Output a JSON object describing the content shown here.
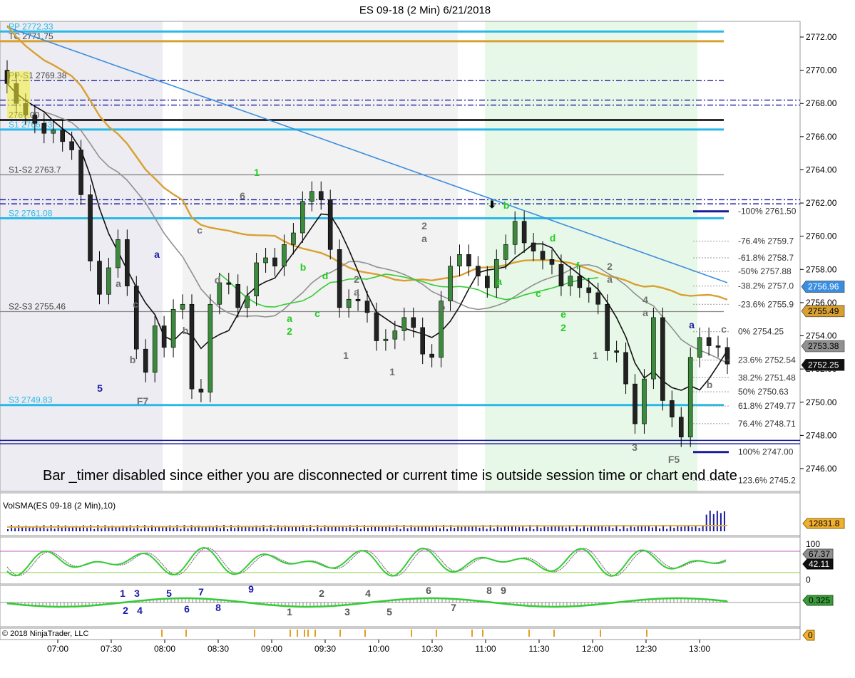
{
  "window_title": "ES 09-18 (2 Min)  6/21/2018",
  "copyright": "© 2018 NinjaTrader, LLC",
  "timer_message": "Bar _timer disabled since either you are disconnected or current time is outside session time or chart end date",
  "colors": {
    "candle_up": "#3c8a3c",
    "candle_down": "#222222",
    "pivot_cyan": "#29b9e8",
    "pivot_navy": "#1a1a9a",
    "ema_gold": "#d8a030",
    "ma_blue": "#3a8ee0",
    "ma_gray": "#909090",
    "ma_black": "#111111",
    "ma_green": "#33cc33",
    "wave_green": "#22cc22",
    "wave_gray": "#707070",
    "wave_blue": "#1a1aaa"
  },
  "chart_data": {
    "type": "candlestick",
    "title": "ES 09-18 (2 Min)  6/21/2018",
    "y_ticks": [
      "2772.00",
      "2770.00",
      "2768.00",
      "2766.00",
      "2764.00",
      "2762.00",
      "2760.00",
      "2758.00",
      "2756.00",
      "2754.00",
      "2752.00",
      "2750.00",
      "2748.00",
      "2746.00"
    ],
    "x_ticks": [
      "07:00",
      "07:30",
      "08:00",
      "08:30",
      "09:00",
      "09:30",
      "10:00",
      "10:30",
      "11:00",
      "11:30",
      "12:00",
      "12:30",
      "13:00"
    ],
    "ylim": [
      2745.5,
      2773.0
    ],
    "price_series": [
      2769.2,
      2768.0,
      2767.3,
      2766.8,
      2766.2,
      2766.4,
      2765.7,
      2765.2,
      2762.5,
      2758.5,
      2756.5,
      2758.1,
      2759.8,
      2757.0,
      2753.2,
      2751.8,
      2754.6,
      2753.3,
      2755.6,
      2755.9,
      2750.8,
      2750.6,
      2755.9,
      2757.2,
      2757.1,
      2755.7,
      2756.4,
      2758.4,
      2758.7,
      2758.2,
      2759.5,
      2760.2,
      2762.1,
      2762.7,
      2762.2,
      2759.2,
      2755.7,
      2756.2,
      2756.1,
      2755.4,
      2753.7,
      2753.8,
      2754.3,
      2755.1,
      2754.5,
      2752.9,
      2752.7,
      2756.1,
      2758.2,
      2758.9,
      2758.2,
      2757.6,
      2756.9,
      2758.6,
      2759.5,
      2760.9,
      2759.6,
      2759.1,
      2758.6,
      2758.3,
      2757.0,
      2757.6,
      2756.9,
      2756.6,
      2755.9,
      2753.1,
      2753.0,
      2751.1,
      2748.7,
      2751.4,
      2755.1,
      2750.1,
      2749.1,
      2747.9,
      2752.7,
      2753.9,
      2753.4,
      2753.3,
      2752.3
    ],
    "horizontal_levels": [
      {
        "label": "PP 2772.33",
        "value": 2772.33,
        "color": "cyan"
      },
      {
        "label": "TC 2771.75",
        "value": 2771.75,
        "color": "gold"
      },
      {
        "label": "PP-S1 2769.38",
        "value": 2769.38,
        "color": "navy"
      },
      {
        "label": "2767.00",
        "value": 2767.0,
        "color": "black"
      },
      {
        "label": "S1 2766.43",
        "value": 2766.43,
        "color": "cyan"
      },
      {
        "label": "S1-S2 2763.7",
        "value": 2763.7,
        "color": "gray"
      },
      {
        "label": "S2 2761.08",
        "value": 2761.08,
        "color": "cyan"
      },
      {
        "label": "S2-S3 2755.46",
        "value": 2755.46,
        "color": "gray"
      },
      {
        "label": "S3 2749.83",
        "value": 2749.83,
        "color": "cyan"
      }
    ],
    "fib_levels": [
      {
        "label": "-100%  2761.50",
        "value": 2761.5
      },
      {
        "label": "-76.4%  2759.7",
        "value": 2759.7
      },
      {
        "label": "-61.8%  2758.7",
        "value": 2758.7
      },
      {
        "label": "-50%  2757.88",
        "value": 2757.88
      },
      {
        "label": "-38.2%  2757.0",
        "value": 2757.0
      },
      {
        "label": "-23.6%  2755.9",
        "value": 2755.9
      },
      {
        "label": "0%  2754.25",
        "value": 2754.25
      },
      {
        "label": "23.6%  2752.54",
        "value": 2752.54
      },
      {
        "label": "38.2%  2751.48",
        "value": 2751.48
      },
      {
        "label": "50%  2750.63",
        "value": 2750.63
      },
      {
        "label": "61.8%  2749.77",
        "value": 2749.77
      },
      {
        "label": "76.4%  2748.71",
        "value": 2748.71
      },
      {
        "label": "100%  2747.00",
        "value": 2747.0
      },
      {
        "label": "123.6%  2745.2",
        "value": 2745.3
      }
    ],
    "price_badges": [
      {
        "label": "2756.96",
        "value": 2756.96,
        "bg": "#3a8ee0",
        "fg": "#ffffff"
      },
      {
        "label": "2755.49",
        "value": 2755.49,
        "bg": "#d8a030",
        "fg": "#000000"
      },
      {
        "label": "2753.38",
        "value": 2753.38,
        "bg": "#909090",
        "fg": "#000000"
      },
      {
        "label": "2752.25",
        "value": 2752.25,
        "bg": "#111111",
        "fg": "#ffffff"
      }
    ],
    "volume_panel": {
      "label": "VolSMA(ES 09-18 (2 Min),10)",
      "badge": "12831.8"
    },
    "stoch_panel": {
      "ticks": [
        "100",
        "0"
      ],
      "badges": [
        "67.37",
        "42.11"
      ]
    },
    "wave_panel": {
      "badges": [
        "0.325"
      ],
      "labels": [
        "1",
        "3",
        "5",
        "7",
        "9",
        "2",
        "4",
        "6",
        "8",
        "1",
        "2",
        "3",
        "4",
        "5",
        "6",
        "7",
        "8",
        "9"
      ]
    },
    "marker_panel": {
      "badge": "0"
    }
  }
}
